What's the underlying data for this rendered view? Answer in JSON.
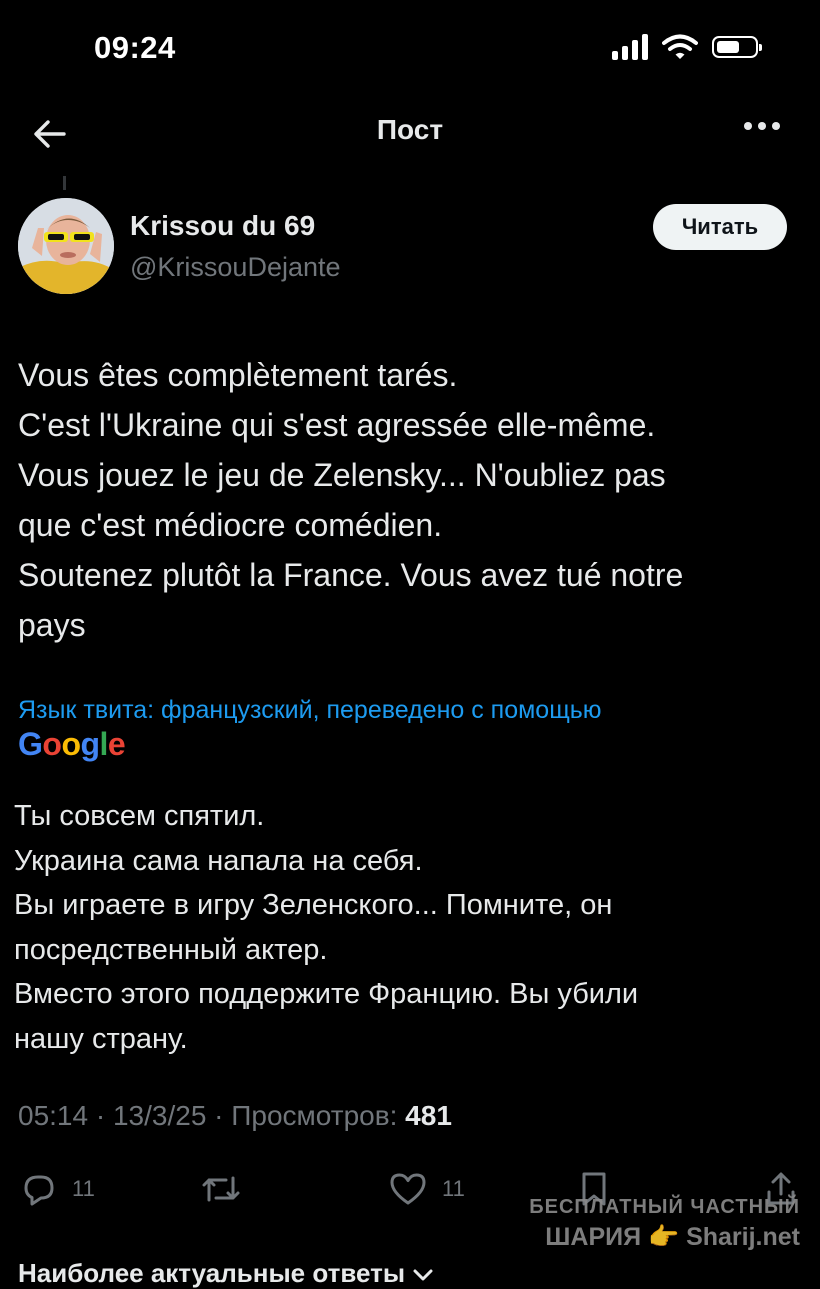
{
  "status_bar": {
    "time": "09:24"
  },
  "nav": {
    "title": "Пост"
  },
  "author": {
    "name": "Krissou du 69",
    "handle": "@KrissouDejante",
    "follow_label": "Читать"
  },
  "tweet": {
    "lines": [
      "Vous êtes complètement tarés.",
      "C'est l'Ukraine qui s'est agressée elle-même.",
      "Vous jouez le jeu de Zelensky... N'oubliez pas",
      "que c'est médiocre comédien.",
      "Soutenez plutôt la France. Vous avez tué notre",
      "pays"
    ]
  },
  "translation": {
    "label": "Язык твита: французский, переведено с помощью",
    "provider": "Google",
    "provider_colors": [
      "#4285F4",
      "#EA4335",
      "#FBBC05",
      "#4285F4",
      "#34A853",
      "#EA4335"
    ],
    "lines": [
      "Ты совсем спятил.",
      "Украина сама напала на себя.",
      "Вы играете в игру Зеленского... Помните, он",
      "посредственный актер.",
      "Вместо этого поддержите Францию. Вы убили",
      "нашу страну."
    ]
  },
  "meta": {
    "time": "05:14",
    "date": "13/3/25",
    "views_label": "Просмотров:",
    "views_count": "481"
  },
  "actions": {
    "replies": "11",
    "likes": "11"
  },
  "watermark": {
    "line1": "БЕСПЛАТНЫЙ ЧАСТНЫЙ",
    "line2": "ШАРИЯ 👉 Sharij.net"
  },
  "replies_header": "Наиболее актуальные ответы",
  "icons": {
    "back": "arrow-left-icon",
    "more": "more-dots-icon",
    "reply": "reply-icon",
    "retweet": "retweet-icon",
    "like": "heart-icon",
    "bookmark": "bookmark-icon",
    "share": "share-icon"
  },
  "colors": {
    "background": "#000000",
    "text": "#e7e9ea",
    "muted": "#71767b",
    "accent": "#1d9bf0"
  }
}
